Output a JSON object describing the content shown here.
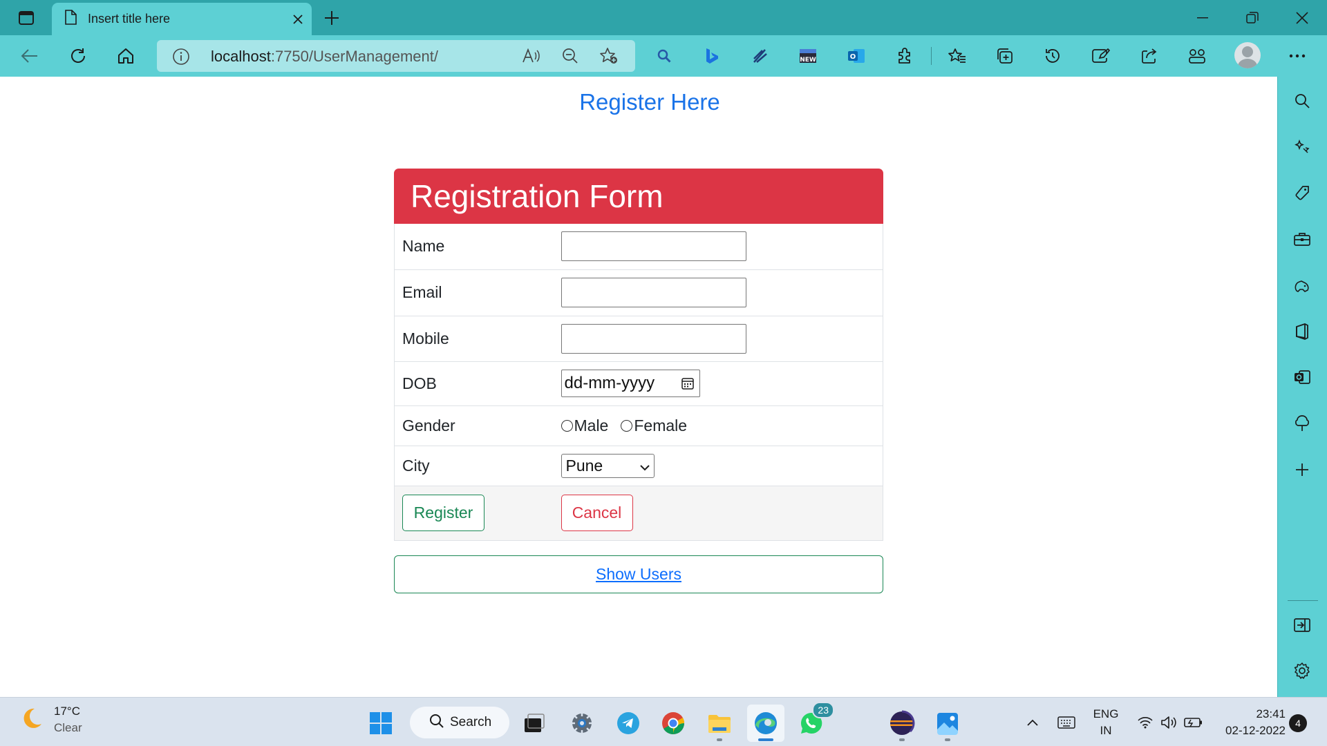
{
  "browser": {
    "tab_title": "Insert title here",
    "url_host": "localhost",
    "url_path": ":7750/UserManagement/"
  },
  "page": {
    "heading": "Register Here",
    "form_title": "Registration Form",
    "fields": {
      "name_label": "Name",
      "email_label": "Email",
      "mobile_label": "Mobile",
      "dob_label": "DOB",
      "dob_placeholder": "dd-mm-yyyy",
      "gender_label": "Gender",
      "gender_options": [
        "Male",
        "Female"
      ],
      "city_label": "City",
      "city_selected": "Pune"
    },
    "register_label": "Register",
    "cancel_label": "Cancel",
    "show_users_label": "Show Users"
  },
  "taskbar": {
    "weather_temp": "17°C",
    "weather_desc": "Clear",
    "search_label": "Search",
    "whatsapp_badge": "23",
    "lang_line1": "ENG",
    "lang_line2": "IN",
    "time": "23:41",
    "date": "02-12-2022",
    "notifications": "4"
  },
  "colors": {
    "titlebar": "#2fa4a9",
    "toolbar": "#5dd0d4",
    "heading_blue": "#1a73e8",
    "form_header_red": "#dc3545",
    "register_green": "#198754",
    "link_blue": "#0d6efd"
  }
}
